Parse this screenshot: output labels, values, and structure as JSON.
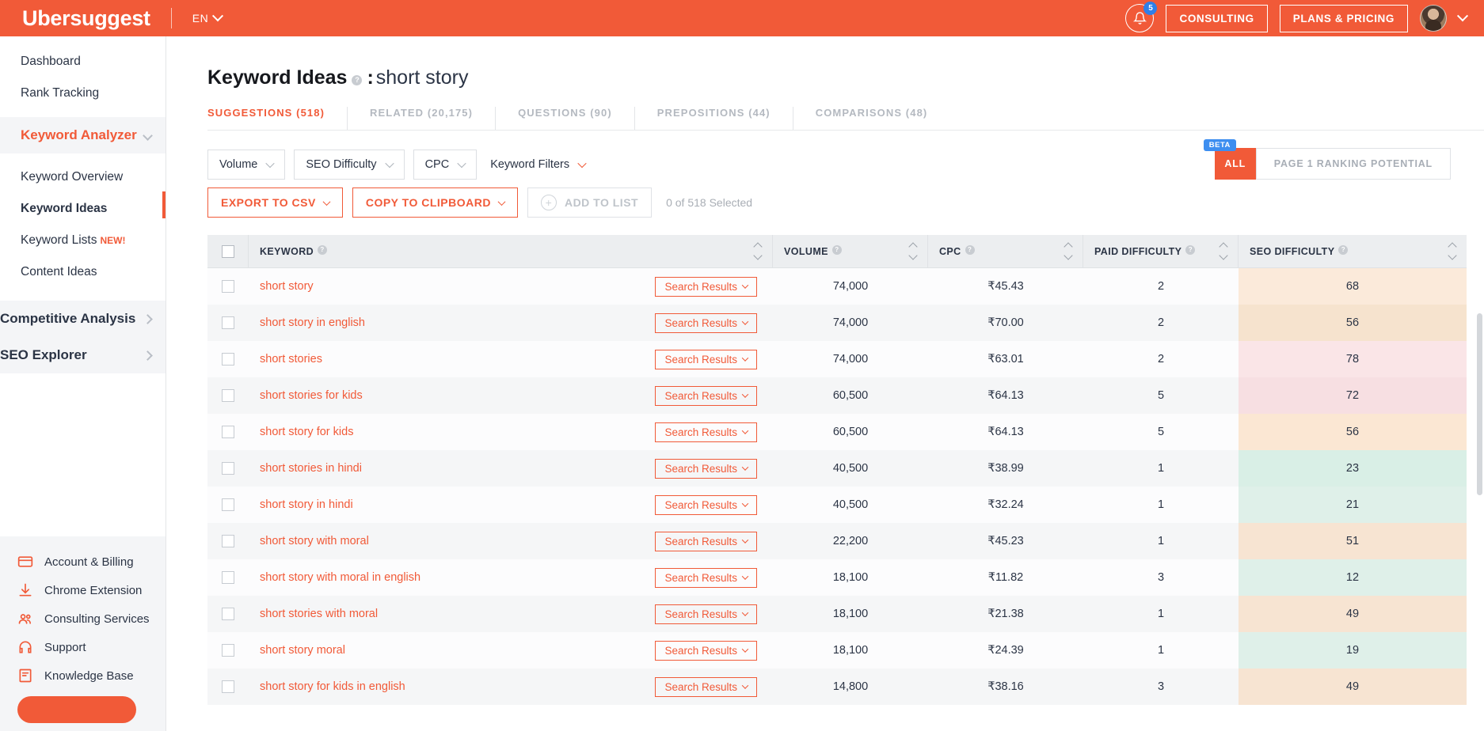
{
  "topbar": {
    "brand": "Ubersuggest",
    "language": "EN",
    "notification_count": "5",
    "consulting_label": "CONSULTING",
    "plans_label": "PLANS & PRICING",
    "accent_color": "#f15a38",
    "badge_color": "#2e7fe8"
  },
  "sidebar": {
    "top_items": [
      {
        "label": "Dashboard"
      },
      {
        "label": "Rank Tracking"
      }
    ],
    "sections": [
      {
        "label": "Keyword Analyzer",
        "expanded": true,
        "items": [
          {
            "label": "Keyword Overview",
            "active": false,
            "badge": ""
          },
          {
            "label": "Keyword Ideas",
            "active": true,
            "badge": ""
          },
          {
            "label": "Keyword Lists",
            "active": false,
            "badge": "NEW!"
          },
          {
            "label": "Content Ideas",
            "active": false,
            "badge": ""
          }
        ]
      },
      {
        "label": "Competitive Analysis",
        "expanded": false,
        "items": []
      },
      {
        "label": "SEO Explorer",
        "expanded": false,
        "items": []
      }
    ],
    "bottom_items": [
      {
        "label": "Account & Billing",
        "icon": "credit-card-icon"
      },
      {
        "label": "Chrome Extension",
        "icon": "download-icon"
      },
      {
        "label": "Consulting Services",
        "icon": "people-icon"
      },
      {
        "label": "Support",
        "icon": "headset-icon"
      },
      {
        "label": "Knowledge Base",
        "icon": "document-icon"
      }
    ]
  },
  "page": {
    "title": "Keyword Ideas",
    "separator": ":",
    "keyword": "short story"
  },
  "tabs": [
    {
      "label": "SUGGESTIONS (518)",
      "active": true
    },
    {
      "label": "RELATED (20,175)",
      "active": false
    },
    {
      "label": "QUESTIONS (90)",
      "active": false
    },
    {
      "label": "PREPOSITIONS (44)",
      "active": false
    },
    {
      "label": "COMPARISONS (48)",
      "active": false
    }
  ],
  "filters": [
    {
      "label": "Volume",
      "boxed": true
    },
    {
      "label": "SEO Difficulty",
      "boxed": true
    },
    {
      "label": "CPC",
      "boxed": true
    },
    {
      "label": "Keyword Filters",
      "boxed": false
    }
  ],
  "view_toggle": {
    "beta_label": "BETA",
    "all_label": "ALL",
    "page1_label": "PAGE 1 RANKING POTENTIAL",
    "active": "ALL"
  },
  "actions": {
    "export_label": "EXPORT TO CSV",
    "copy_label": "COPY TO CLIPBOARD",
    "add_to_list_label": "ADD TO LIST",
    "selected_text": "0 of 518 Selected"
  },
  "table": {
    "columns": [
      {
        "label": "KEYWORD",
        "has_help": true,
        "sortable": true
      },
      {
        "label": "VOLUME",
        "has_help": true,
        "sortable": true
      },
      {
        "label": "CPC",
        "has_help": true,
        "sortable": true
      },
      {
        "label": "PAID DIFFICULTY",
        "has_help": true,
        "sortable": true
      },
      {
        "label": "SEO DIFFICULTY",
        "has_help": true,
        "sortable": true
      }
    ],
    "row_button_label": "Search Results",
    "rows": [
      {
        "keyword": "short story",
        "volume": "74,000",
        "cpc": "₹45.43",
        "paid": "2",
        "seo": "68",
        "seo_color": "#fbeada"
      },
      {
        "keyword": "short story in english",
        "volume": "74,000",
        "cpc": "₹70.00",
        "paid": "2",
        "seo": "56",
        "seo_color": "#f6e3ce"
      },
      {
        "keyword": "short stories",
        "volume": "74,000",
        "cpc": "₹63.01",
        "paid": "2",
        "seo": "78",
        "seo_color": "#fae5e7"
      },
      {
        "keyword": "short stories for kids",
        "volume": "60,500",
        "cpc": "₹64.13",
        "paid": "5",
        "seo": "72",
        "seo_color": "#f7dfe2"
      },
      {
        "keyword": "short story for kids",
        "volume": "60,500",
        "cpc": "₹64.13",
        "paid": "5",
        "seo": "56",
        "seo_color": "#fbe7d3"
      },
      {
        "keyword": "short stories in hindi",
        "volume": "40,500",
        "cpc": "₹38.99",
        "paid": "1",
        "seo": "23",
        "seo_color": "#d9efe6"
      },
      {
        "keyword": "short story in hindi",
        "volume": "40,500",
        "cpc": "₹32.24",
        "paid": "1",
        "seo": "21",
        "seo_color": "#dff0e9"
      },
      {
        "keyword": "short story with moral",
        "volume": "22,200",
        "cpc": "₹45.23",
        "paid": "1",
        "seo": "51",
        "seo_color": "#f7e4d2"
      },
      {
        "keyword": "short story with moral in english",
        "volume": "18,100",
        "cpc": "₹11.82",
        "paid": "3",
        "seo": "12",
        "seo_color": "#dff0e9"
      },
      {
        "keyword": "short stories with moral",
        "volume": "18,100",
        "cpc": "₹21.38",
        "paid": "1",
        "seo": "49",
        "seo_color": "#f7e4d2"
      },
      {
        "keyword": "short story moral",
        "volume": "18,100",
        "cpc": "₹24.39",
        "paid": "1",
        "seo": "19",
        "seo_color": "#dff0e9"
      },
      {
        "keyword": "short story for kids in english",
        "volume": "14,800",
        "cpc": "₹38.16",
        "paid": "3",
        "seo": "49",
        "seo_color": "#f7e4d2"
      }
    ]
  }
}
